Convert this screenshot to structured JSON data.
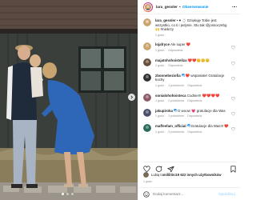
{
  "header": {
    "username": "lara_gessler",
    "separator": "•",
    "follow_label": "Obserwowanie"
  },
  "caption": {
    "username": "lara_gessler",
    "text": " • ♥ 💍 Dziękuję Tobie jest wszystko, co ti i jedynie. Stu tak @jossoczebg 🙌 #niekrzy",
    "time": "1 godz."
  },
  "comments": [
    {
      "username": "lojafryce",
      "verified": false,
      "text": "Ale super ❤️",
      "avatar_color": "#c9a46e",
      "time": "1 godz.",
      "likes": "",
      "reply": "Odpowiedz"
    },
    {
      "username": "majatohohoisteliza",
      "verified": false,
      "text": "❤️❤️😊😊😊",
      "avatar_color": "#6a4f3e",
      "time": "1 godz.",
      "likes": "",
      "reply": "Odpowiedz"
    },
    {
      "username": "zbonnebeziofia",
      "verified": true,
      "text": "❤️ wspaniale! Gratulacje kochy",
      "avatar_color": "#2f2f2f",
      "time": "1 godz.",
      "likes": "1 polubienie",
      "reply": "Odpowiedz"
    },
    {
      "username": "sonialohohoisteca",
      "verified": false,
      "text": "Cudnie!!! ❤️❤️❤️❤️",
      "avatar_color": "#8b5a66",
      "time": "1 godz.",
      "likes": "2 polubienia",
      "reply": "Odpowiedz"
    },
    {
      "username": "jakupiroka",
      "verified": true,
      "text": "O woow 💗 gratulacje dla Was",
      "avatar_color": "#4a4f6a",
      "time": "1 godz.",
      "likes": "1 polubienie",
      "reply": "Odpowiedz"
    },
    {
      "username": "maffeefam_official",
      "verified": true,
      "text": "Gratulacje dla Was!!! ❤️",
      "avatar_color": "#2b6a5b",
      "time": "1 godz.",
      "likes": "3 polubienia",
      "reply": "Odpowiedz"
    }
  ],
  "likes": {
    "prefix": "Lubią to ",
    "user": "mililitin",
    "middle": " i ",
    "others": "19 622 innych użytkowników"
  },
  "date": "1 godz.",
  "composer": {
    "placeholder": "Dodaj komentarz...",
    "post_label": "Opublikuj"
  },
  "colors": {
    "accent": "#0095f6",
    "verified": "#3897f0",
    "like_red": "#ed4956",
    "muted": "#8e8e8e"
  },
  "icons": [
    "heart-icon",
    "comment-icon",
    "share-icon",
    "bookmark-icon",
    "emoji-icon",
    "more-icon",
    "chevron-right-icon"
  ]
}
